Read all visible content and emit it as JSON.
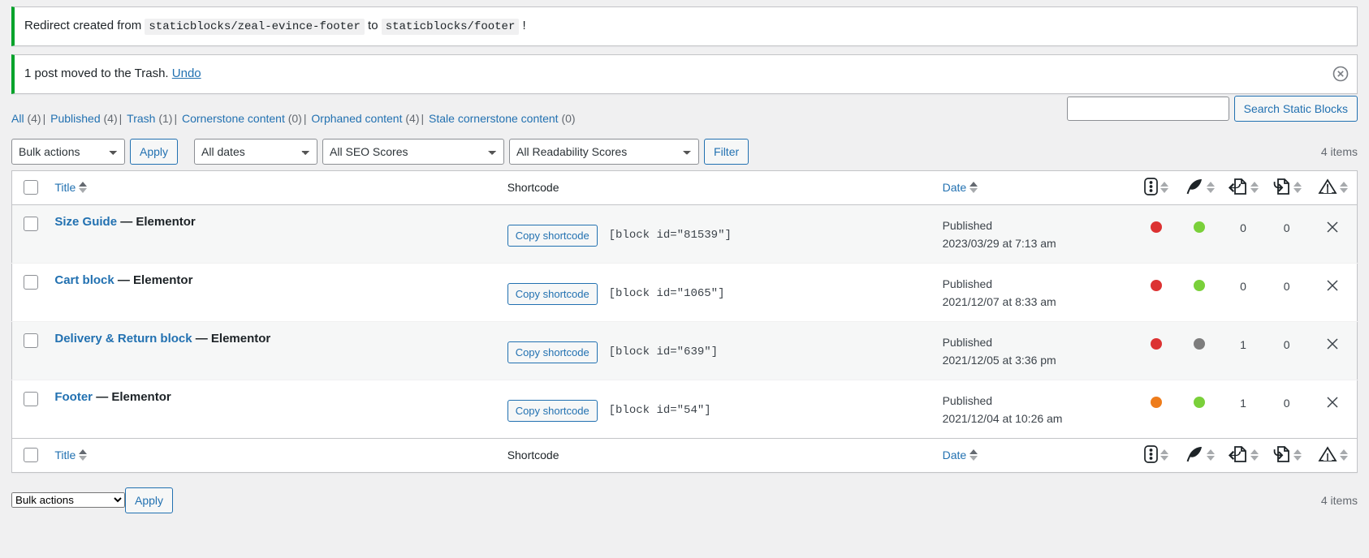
{
  "notices": [
    {
      "id": "redirect-notice",
      "text_before": "Redirect created from",
      "code_from": "staticblocks/zeal-evince-footer",
      "text_middle": "to",
      "code_to": "staticblocks/footer",
      "text_after": "!",
      "dismissible": false,
      "accent": "#00a32a"
    },
    {
      "id": "trash-notice",
      "text_before": "1 post moved to the Trash.",
      "link_label": "Undo",
      "dismissible": true,
      "accent": "#00a32a"
    }
  ],
  "filter_links": [
    {
      "label": "All",
      "count": "(4)"
    },
    {
      "label": "Published",
      "count": "(4)"
    },
    {
      "label": "Trash",
      "count": "(1)"
    },
    {
      "label": "Cornerstone content",
      "count": "(0)"
    },
    {
      "label": "Orphaned content",
      "count": "(4)"
    },
    {
      "label": "Stale cornerstone content",
      "count": "(0)"
    }
  ],
  "search": {
    "value": "",
    "placeholder": "",
    "button_label": "Search Static Blocks"
  },
  "tablenav_top": {
    "bulk_actions": "Bulk actions",
    "apply_label": "Apply",
    "dates": "All dates",
    "seo_scores": "All SEO Scores",
    "readability_scores": "All Readability Scores",
    "filter_label": "Filter",
    "displaying_num": "4 items"
  },
  "tablenav_bottom": {
    "bulk_actions": "Bulk actions",
    "apply_label": "Apply",
    "displaying_num": "4 items"
  },
  "table": {
    "headers": {
      "title": "Title",
      "shortcode": "Shortcode",
      "date": "Date",
      "icon_readability": "readability-meter-icon",
      "icon_seo": "yoast-feather-icon",
      "icon_incoming_links": "incoming-links-icon",
      "icon_outgoing_links": "outgoing-links-icon",
      "icon_warning": "warning-triangle-icon"
    },
    "rows": [
      {
        "title": "Size Guide",
        "title_suffix": " — Elementor",
        "copy_label": "Copy shortcode",
        "shortcode": "[block id=\"81539\"]",
        "status": "Published",
        "date": "2023/03/29 at 7:13 am",
        "seo_color": "#dc3232",
        "readability_color": "#7ad03a",
        "incoming": "0",
        "outgoing": "0"
      },
      {
        "title": "Cart block",
        "title_suffix": " — Elementor",
        "copy_label": "Copy shortcode",
        "shortcode": "[block id=\"1065\"]",
        "status": "Published",
        "date": "2021/12/07 at 8:33 am",
        "seo_color": "#dc3232",
        "readability_color": "#7ad03a",
        "incoming": "0",
        "outgoing": "0"
      },
      {
        "title": "Delivery & Return block",
        "title_suffix": " — Elementor",
        "copy_label": "Copy shortcode",
        "shortcode": "[block id=\"639\"]",
        "status": "Published",
        "date": "2021/12/05 at 3:36 pm",
        "seo_color": "#dc3232",
        "readability_color": "#7d7d7d",
        "incoming": "1",
        "outgoing": "0"
      },
      {
        "title": "Footer",
        "title_suffix": " — Elementor",
        "copy_label": "Copy shortcode",
        "shortcode": "[block id=\"54\"]",
        "status": "Published",
        "date": "2021/12/04 at 10:26 am",
        "seo_color": "#ee7c1b",
        "readability_color": "#7ad03a",
        "incoming": "1",
        "outgoing": "0"
      }
    ]
  },
  "colors": {
    "accent_blue": "#2271b1",
    "notice_green": "#00a32a",
    "page_bg": "#f0f0f1"
  }
}
